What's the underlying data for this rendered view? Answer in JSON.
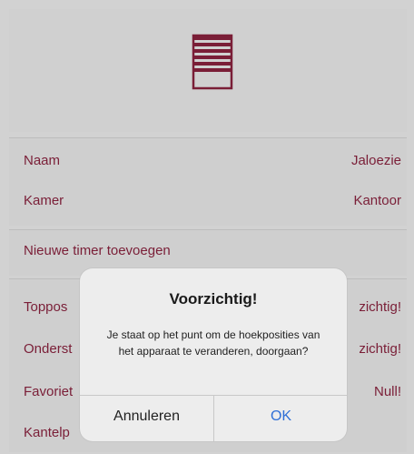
{
  "rows": {
    "naam": {
      "label": "Naam",
      "value": "Jaloezie"
    },
    "kamer": {
      "label": "Kamer",
      "value": "Kantoor"
    },
    "timer": {
      "label": "Nieuwe timer toevoegen"
    },
    "toppos": {
      "label": "Toppos",
      "value": "zichtig!"
    },
    "onders": {
      "label": "Onderst",
      "value": "zichtig!"
    },
    "favoriet": {
      "label": "Favoriet",
      "value": "Null!"
    },
    "kantel": {
      "label": "Kantelp"
    }
  },
  "dialog": {
    "title": "Voorzichtig!",
    "message": "Je staat op het punt om de hoekposities van het apparaat te veranderen, doorgaan?",
    "cancel_label": "Annuleren",
    "ok_label": "OK"
  },
  "colors": {
    "accent": "#7a1e37",
    "link": "#2f6fd6"
  },
  "icons": {
    "header": "window-blind-icon"
  }
}
